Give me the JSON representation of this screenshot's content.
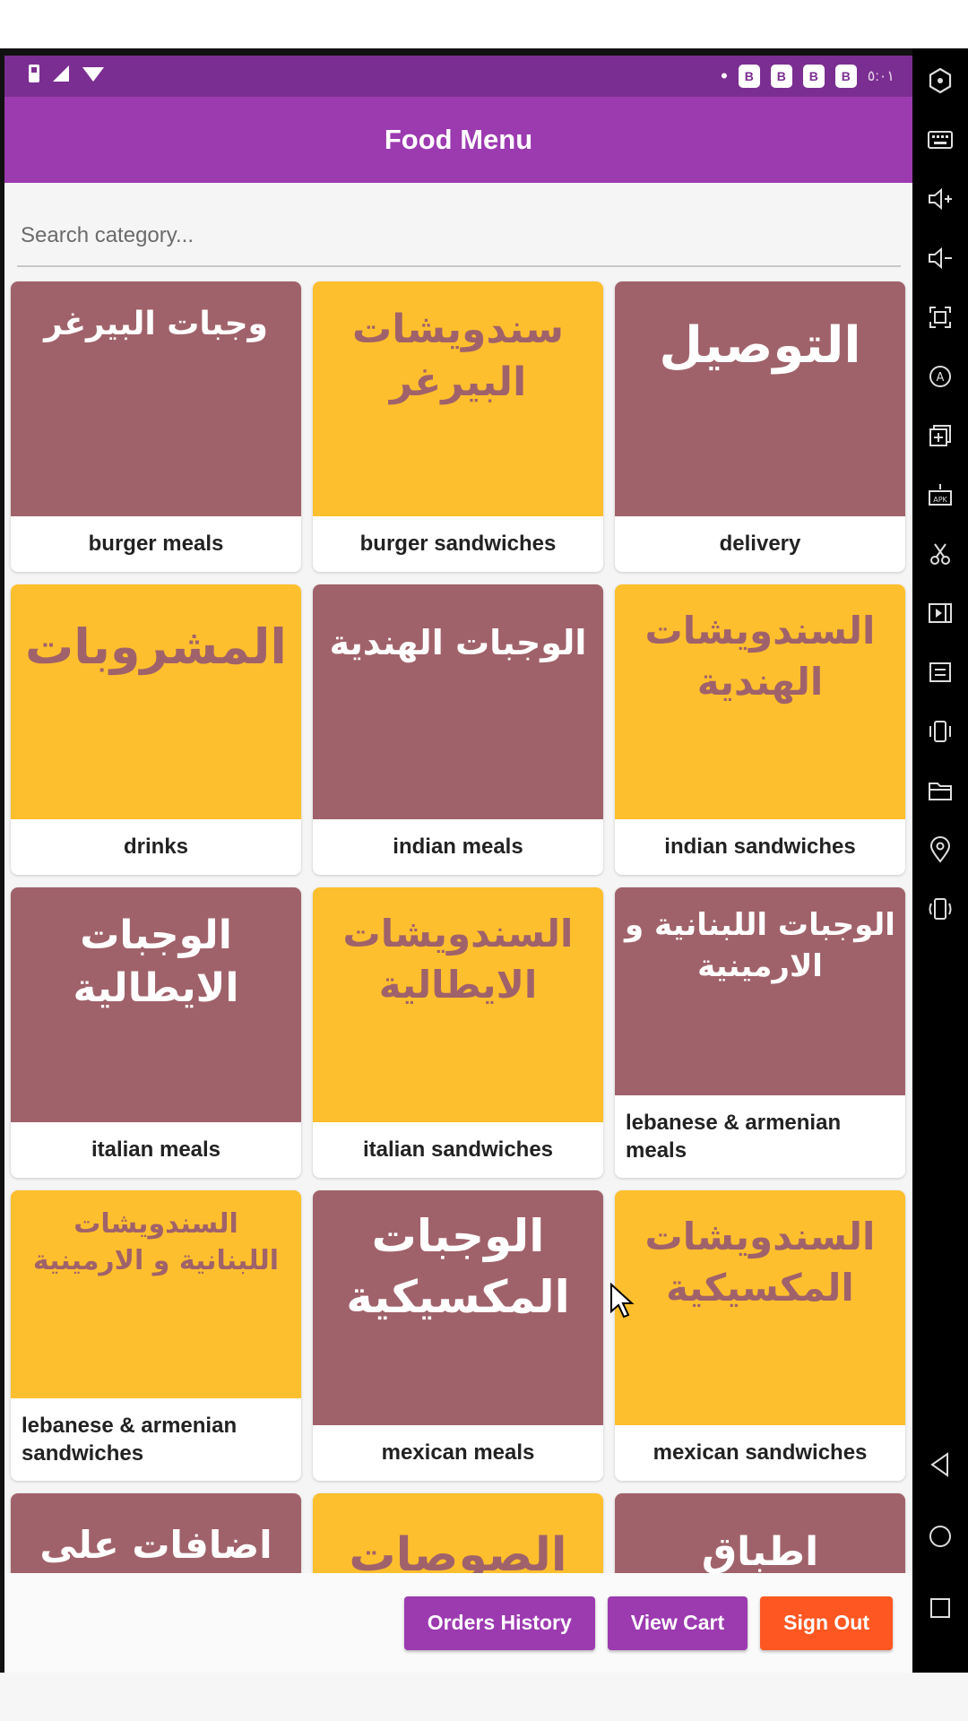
{
  "app": {
    "title": "Food Menu"
  },
  "status_bar": {
    "time": "٥:٠١",
    "dot": "•",
    "notification_icons": [
      "B",
      "B",
      "B",
      "B"
    ]
  },
  "search": {
    "placeholder": "Search category..."
  },
  "categories": [
    {
      "arabic": "وجبات البيرغر",
      "label": "burger meals",
      "theme": "maroon"
    },
    {
      "arabic": "سندويشات البيرغر",
      "label": "burger sandwiches",
      "theme": "yellow"
    },
    {
      "arabic": "التوصيل",
      "label": "delivery",
      "theme": "maroon"
    },
    {
      "arabic": "المشروبات",
      "label": "drinks",
      "theme": "yellow"
    },
    {
      "arabic": "الوجبات الهندية",
      "label": "indian meals",
      "theme": "maroon"
    },
    {
      "arabic": "السندويشات الهندية",
      "label": "indian sandwiches",
      "theme": "yellow"
    },
    {
      "arabic": "الوجبات الايطالية",
      "label": "italian meals",
      "theme": "maroon"
    },
    {
      "arabic": "السندويشات الايطالية",
      "label": "italian sandwiches",
      "theme": "yellow"
    },
    {
      "arabic": "الوجبات اللبنانية و الارمينية",
      "label": "lebanese & armenian meals",
      "theme": "maroon"
    },
    {
      "arabic": "السندويشات اللبنانية و الارمينية",
      "label": "lebanese & armenian sandwiches",
      "theme": "yellow"
    },
    {
      "arabic": "الوجبات المكسيكية",
      "label": "mexican meals",
      "theme": "maroon"
    },
    {
      "arabic": "السندويشات المكسيكية",
      "label": "mexican sandwiches",
      "theme": "yellow"
    },
    {
      "arabic": "اضافات على",
      "label": "",
      "theme": "maroon"
    },
    {
      "arabic": "الصوصات",
      "label": "",
      "theme": "yellow"
    },
    {
      "arabic": "اطباق البطاطا",
      "label": "",
      "theme": "maroon"
    }
  ],
  "actions": {
    "orders_history": "Orders History",
    "view_cart": "View Cart",
    "sign_out": "Sign Out"
  },
  "colors": {
    "app_bar": "#9c3ab0",
    "status_bar": "#7b2e91",
    "card_maroon": "#a0626a",
    "card_yellow": "#fdbf2d",
    "sign_out": "#ff5722"
  },
  "emulator_toolbar": {
    "icons": [
      "power-icon",
      "keyboard-icon",
      "volume-up-icon",
      "volume-down-icon",
      "screenshot-icon",
      "auto-rotate-icon",
      "add-window-icon",
      "apk-install-icon",
      "cut-icon",
      "screen-record-icon",
      "transfer-icon",
      "vibrate-icon",
      "folder-icon",
      "location-icon",
      "shake-icon"
    ],
    "nav_icons": [
      "back-icon",
      "home-icon",
      "recents-icon"
    ]
  }
}
